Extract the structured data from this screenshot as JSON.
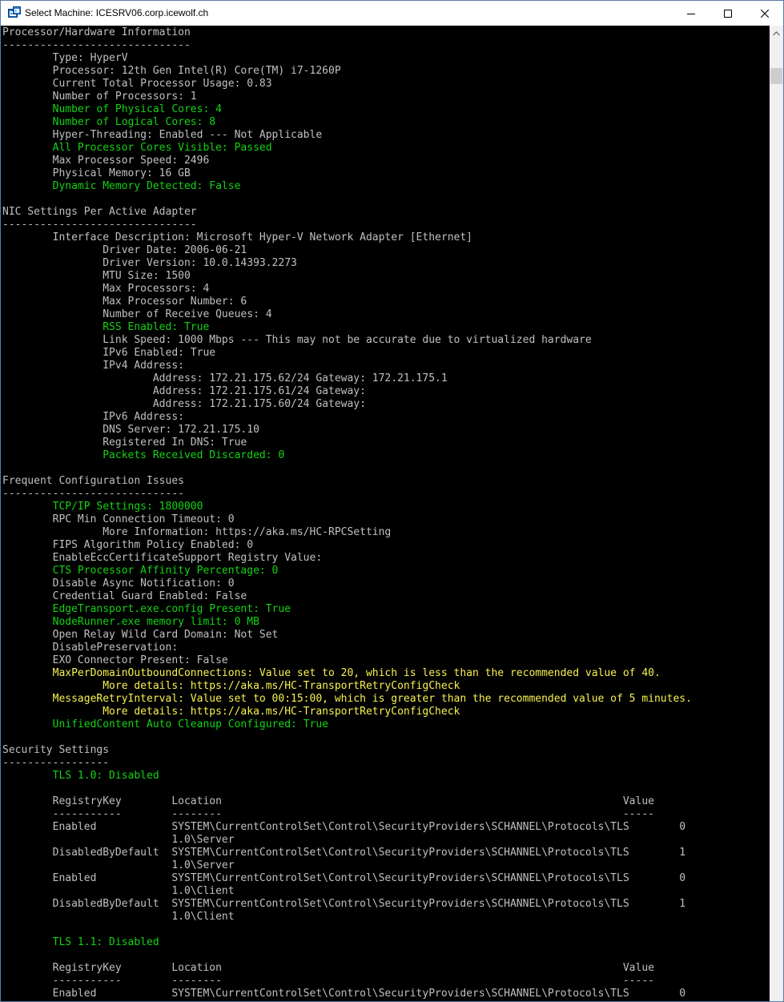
{
  "window": {
    "title": "Select Machine: ICESRV06.corp.icewolf.ch",
    "app_icon": "console-icon",
    "controls": {
      "minimize": "minimize-icon",
      "maximize": "maximize-icon",
      "close": "close-icon"
    }
  },
  "colors": {
    "default": "#c0c0c0",
    "green": "#13d313",
    "yellow": "#f9f14f",
    "background": "#000000"
  },
  "console": {
    "lines": [
      {
        "text": "Processor/Hardware Information",
        "color": "w"
      },
      {
        "text": "------------------------------",
        "color": "w"
      },
      {
        "text": "        Type: HyperV",
        "color": "w"
      },
      {
        "text": "        Processor: 12th Gen Intel(R) Core(TM) i7-1260P",
        "color": "w"
      },
      {
        "text": "        Current Total Processor Usage: 0.83",
        "color": "w"
      },
      {
        "text": "        Number of Processors: 1",
        "color": "w"
      },
      {
        "text": "        Number of Physical Cores: 4",
        "color": "g"
      },
      {
        "text": "        Number of Logical Cores: 8",
        "color": "g"
      },
      {
        "text": "        Hyper-Threading: Enabled --- Not Applicable",
        "color": "w"
      },
      {
        "text": "        All Processor Cores Visible: Passed",
        "color": "g"
      },
      {
        "text": "        Max Processor Speed: 2496",
        "color": "w"
      },
      {
        "text": "        Physical Memory: 16 GB",
        "color": "w"
      },
      {
        "text": "        Dynamic Memory Detected: False",
        "color": "g"
      },
      {
        "text": "",
        "color": "w"
      },
      {
        "text": "NIC Settings Per Active Adapter",
        "color": "w"
      },
      {
        "text": "-------------------------------",
        "color": "w"
      },
      {
        "text": "        Interface Description: Microsoft Hyper-V Network Adapter [Ethernet]",
        "color": "w"
      },
      {
        "text": "                Driver Date: 2006-06-21",
        "color": "w"
      },
      {
        "text": "                Driver Version: 10.0.14393.2273",
        "color": "w"
      },
      {
        "text": "                MTU Size: 1500",
        "color": "w"
      },
      {
        "text": "                Max Processors: 4",
        "color": "w"
      },
      {
        "text": "                Max Processor Number: 6",
        "color": "w"
      },
      {
        "text": "                Number of Receive Queues: 4",
        "color": "w"
      },
      {
        "text": "                RSS Enabled: True",
        "color": "g"
      },
      {
        "text": "                Link Speed: 1000 Mbps --- This may not be accurate due to virtualized hardware",
        "color": "w"
      },
      {
        "text": "                IPv6 Enabled: True",
        "color": "w"
      },
      {
        "text": "                IPv4 Address:",
        "color": "w"
      },
      {
        "text": "                        Address: 172.21.175.62/24 Gateway: 172.21.175.1",
        "color": "w"
      },
      {
        "text": "                        Address: 172.21.175.61/24 Gateway:",
        "color": "w"
      },
      {
        "text": "                        Address: 172.21.175.60/24 Gateway:",
        "color": "w"
      },
      {
        "text": "                IPv6 Address:",
        "color": "w"
      },
      {
        "text": "                DNS Server: 172.21.175.10",
        "color": "w"
      },
      {
        "text": "                Registered In DNS: True",
        "color": "w"
      },
      {
        "text": "                Packets Received Discarded: 0",
        "color": "g"
      },
      {
        "text": "",
        "color": "w"
      },
      {
        "text": "Frequent Configuration Issues",
        "color": "w"
      },
      {
        "text": "-----------------------------",
        "color": "w"
      },
      {
        "text": "        TCP/IP Settings: 1800000",
        "color": "g"
      },
      {
        "text": "        RPC Min Connection Timeout: 0",
        "color": "w"
      },
      {
        "text": "                More Information: https://aka.ms/HC-RPCSetting",
        "color": "w"
      },
      {
        "text": "        FIPS Algorithm Policy Enabled: 0",
        "color": "w"
      },
      {
        "text": "        EnableEccCertificateSupport Registry Value:",
        "color": "w"
      },
      {
        "text": "        CTS Processor Affinity Percentage: 0",
        "color": "g"
      },
      {
        "text": "        Disable Async Notification: 0",
        "color": "w"
      },
      {
        "text": "        Credential Guard Enabled: False",
        "color": "w"
      },
      {
        "text": "        EdgeTransport.exe.config Present: True",
        "color": "g"
      },
      {
        "text": "        NodeRunner.exe memory limit: 0 MB",
        "color": "g"
      },
      {
        "text": "        Open Relay Wild Card Domain: Not Set",
        "color": "w"
      },
      {
        "text": "        DisablePreservation:",
        "color": "w"
      },
      {
        "text": "        EXO Connector Present: False",
        "color": "w"
      },
      {
        "text": "        MaxPerDomainOutboundConnections: Value set to 20, which is less than the recommended value of 40.",
        "color": "y"
      },
      {
        "text": "                More details: https://aka.ms/HC-TransportRetryConfigCheck",
        "color": "y"
      },
      {
        "text": "        MessageRetryInterval: Value set to 00:15:00, which is greater than the recommended value of 5 minutes.",
        "color": "y"
      },
      {
        "text": "                More details: https://aka.ms/HC-TransportRetryConfigCheck",
        "color": "y"
      },
      {
        "text": "        UnifiedContent Auto Cleanup Configured: True",
        "color": "g"
      },
      {
        "text": "",
        "color": "w"
      },
      {
        "text": "Security Settings",
        "color": "w"
      },
      {
        "text": "-----------------",
        "color": "w"
      },
      {
        "text": "        TLS 1.0: Disabled",
        "color": "g"
      },
      {
        "text": "",
        "color": "w"
      },
      {
        "text": "        RegistryKey        Location                                                                Value",
        "color": "w"
      },
      {
        "text": "        -----------        --------                                                                -----",
        "color": "w"
      },
      {
        "text": "        Enabled            SYSTEM\\CurrentControlSet\\Control\\SecurityProviders\\SCHANNEL\\Protocols\\TLS        0",
        "color": "w"
      },
      {
        "text": "                           1.0\\Server",
        "color": "w"
      },
      {
        "text": "        DisabledByDefault  SYSTEM\\CurrentControlSet\\Control\\SecurityProviders\\SCHANNEL\\Protocols\\TLS        1",
        "color": "w"
      },
      {
        "text": "                           1.0\\Server",
        "color": "w"
      },
      {
        "text": "        Enabled            SYSTEM\\CurrentControlSet\\Control\\SecurityProviders\\SCHANNEL\\Protocols\\TLS        0",
        "color": "w"
      },
      {
        "text": "                           1.0\\Client",
        "color": "w"
      },
      {
        "text": "        DisabledByDefault  SYSTEM\\CurrentControlSet\\Control\\SecurityProviders\\SCHANNEL\\Protocols\\TLS        1",
        "color": "w"
      },
      {
        "text": "                           1.0\\Client",
        "color": "w"
      },
      {
        "text": "",
        "color": "w"
      },
      {
        "text": "        TLS 1.1: Disabled",
        "color": "g"
      },
      {
        "text": "",
        "color": "w"
      },
      {
        "text": "        RegistryKey        Location                                                                Value",
        "color": "w"
      },
      {
        "text": "        -----------        --------                                                                -----",
        "color": "w"
      },
      {
        "text": "        Enabled            SYSTEM\\CurrentControlSet\\Control\\SecurityProviders\\SCHANNEL\\Protocols\\TLS        0",
        "color": "w"
      }
    ]
  },
  "scrollbar": {
    "up_icon": "scroll-up-arrow-icon",
    "position_fraction": 0.03
  }
}
